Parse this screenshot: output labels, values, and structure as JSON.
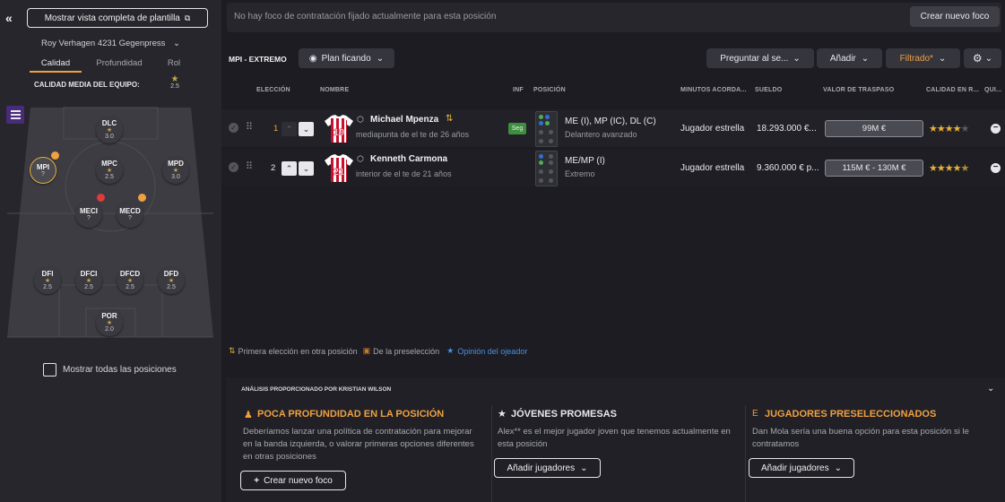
{
  "sidebar": {
    "collapse_icon": "double-chevron-left-icon",
    "show_full_squad_label": "Mostrar vista completa de plantilla",
    "formation_selector": "Roy Verhagen 4231 Gegenpress",
    "tabs": [
      "Calidad",
      "Profundidad",
      "Rol"
    ],
    "team_avg_label": "CALIDAD MEDIA DEL EQUIPO:",
    "team_avg_value": "2.5",
    "positions": [
      {
        "label": "DLC",
        "value": "3.0"
      },
      {
        "label": "MPI",
        "value": "?"
      },
      {
        "label": "MPC",
        "value": "2.5"
      },
      {
        "label": "MPD",
        "value": "3.0"
      },
      {
        "label": "MECI",
        "value": "?"
      },
      {
        "label": "MECD",
        "value": "?"
      },
      {
        "label": "DFI",
        "value": "2.5"
      },
      {
        "label": "DFCI",
        "value": "2.5"
      },
      {
        "label": "DFCD",
        "value": "2.5"
      },
      {
        "label": "DFD",
        "value": "2.5"
      },
      {
        "label": "POR",
        "value": "2.0"
      }
    ],
    "show_all_positions_label": "Mostrar todas las posiciones"
  },
  "top": {
    "no_focus_text": "No hay foco de contratación fijado actualmente para esta posición",
    "create_focus_button": "Crear nuevo foco"
  },
  "toolbar": {
    "position_title": "MPI - EXTREMO",
    "view_selector": "Plan ficando",
    "ask_button": "Preguntar al se...",
    "add_button": "Añadir",
    "filter_button": "Filtrado*"
  },
  "table": {
    "headers": [
      "ELECCIÓN",
      "NOMBRE",
      "INF",
      "POSICIÓN",
      "MINUTOS ACORDA...",
      "SUELDO",
      "VALOR DE TRASPASO",
      "CALIDAD EN R...",
      "QUI..."
    ],
    "rows": [
      {
        "choice": "1",
        "shirt_number": "19",
        "name": "Michael Mpenza",
        "subtitle": "mediapunta de el te de 26 años",
        "info_badge": "Seg",
        "positions": "ME (I), MP (IC), DL (C)",
        "role": "Delantero avanzado",
        "minutes": "Jugador estrella",
        "wage": "18.293.000 €...",
        "value": "99M €",
        "rating_stars": 3.5
      },
      {
        "choice": "2",
        "shirt_number": "21",
        "name": "Kenneth Carmona",
        "subtitle": "interior de el te de 21 años",
        "info_badge": "",
        "positions": "ME/MP (I)",
        "role": "Extremo",
        "minutes": "Jugador estrella",
        "wage": "9.360.000 € p...",
        "value": "115M € - 130M €",
        "rating_stars": 4.5
      }
    ]
  },
  "legend": {
    "first_choice": "Primera elección en otra posición",
    "shortlist": "De la preselección",
    "scout_opinion": "Opinión del ojeador"
  },
  "analysis": {
    "provided_by": "ANÁLISIS PROPORCIONADO POR KRISTIAN WILSON",
    "panels": [
      {
        "icon": "person-alert-icon",
        "title": "POCA PROFUNDIDAD EN LA POSICIÓN",
        "title_color": "#f0a040",
        "text": "Deberíamos lanzar una política de contratación para mejorar en la banda izquierda, o valorar primeras opciones diferentes en otras posiciones",
        "button": "Crear nuevo foco"
      },
      {
        "icon": "star-icon",
        "title": "JÓVENES PROMESAS",
        "title_color": "#e8e8ec",
        "text": "Alex** es el mejor jugador joven que tenemos actualmente en esta posición",
        "button": "Añadir jugadores"
      },
      {
        "icon": "shortlist-icon",
        "title": "JUGADORES PRESELECCIONADOS",
        "title_color": "#f0a040",
        "text": "Dan Mola sería una buena opción para esta posición si le contratamos",
        "button": "Añadir jugadores"
      }
    ]
  },
  "colors": {
    "accent": "#f0a040",
    "gold": "#c9a24a",
    "shirt_red": "#c8102e"
  }
}
